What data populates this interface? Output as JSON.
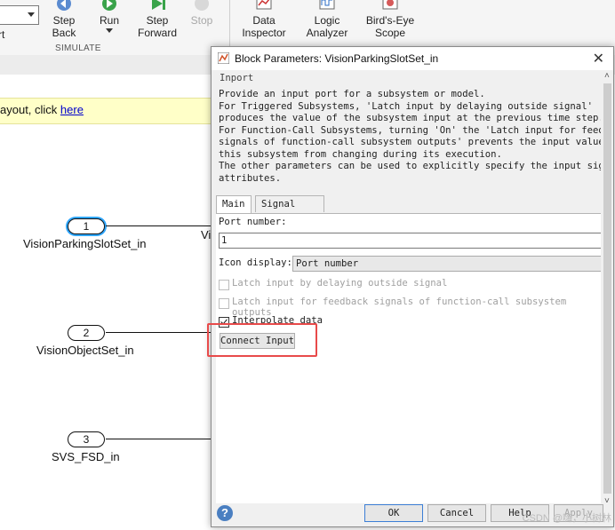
{
  "toolstrip": {
    "partial_left_text": "rt",
    "step_back": "Step\nBack",
    "run": "Run",
    "step_forward": "Step\nForward",
    "stop": "Stop",
    "simulate_section": "SIMULATE",
    "data_inspector": "Data\nInspector",
    "logic_analyzer": "Logic\nAnalyzer",
    "birds_eye": "Bird's-Eye\nScope"
  },
  "canvas": {
    "notice_text": "ayout, click ",
    "notice_link": "here",
    "ports": [
      {
        "number": "1",
        "label": "VisionParkingSlotSet_in"
      },
      {
        "number": "2",
        "label": "VisionObjectSet_in"
      },
      {
        "number": "3",
        "label": "SVS_FSD_in"
      }
    ],
    "partial_block_text": "Vi"
  },
  "dialog": {
    "title": "Block Parameters: VisionParkingSlotSet_in",
    "group_title": "Inport",
    "description": "Provide an input port for a subsystem or model.\nFor Triggered Subsystems, 'Latch input by delaying outside signal'\nproduces the value of the subsystem input at the previous time step.\nFor Function-Call Subsystems, turning 'On' the 'Latch input for feedbac\nsignals of function-call subsystem outputs' prevents the input value to\nthis subsystem from changing during its execution.\nThe other parameters can be used to explicitly specify the input signal\nattributes.",
    "tabs": [
      "Main",
      "Signal Attributes"
    ],
    "port_number_label": "Port number:",
    "port_number_value": "1",
    "icon_display_label": "Icon display:",
    "icon_display_value": "Port number",
    "latch_outside_label": "Latch input by delaying outside signal",
    "latch_outside_checked": false,
    "latch_feedback_label": "Latch input for feedback signals of function-call subsystem outputs",
    "latch_feedback_checked": false,
    "interpolate_label": "Interpolate data",
    "interpolate_checked": true,
    "connect_input": "Connect Input",
    "ok": "OK",
    "cancel": "Cancel",
    "help": "Help",
    "apply": "Apply"
  },
  "watermark": "CSDN @嗨，小树林",
  "colors": {
    "highlight": "#e84a4a",
    "selected_port": "#2ea6ff",
    "notice_bg": "#ffffc8"
  }
}
